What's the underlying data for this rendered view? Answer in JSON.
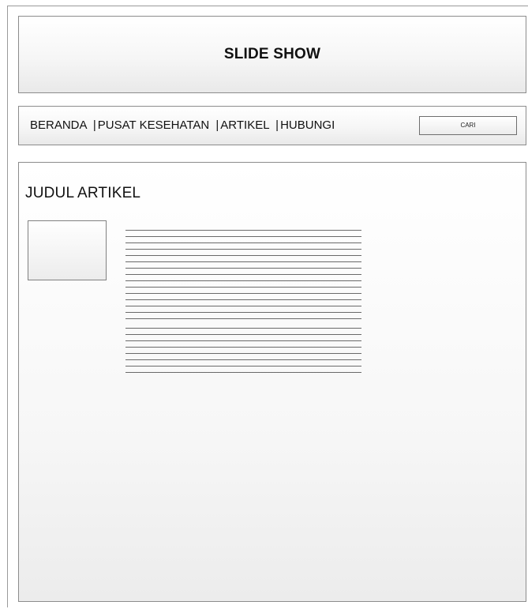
{
  "slideshow": {
    "title": "SLIDE SHOW"
  },
  "nav": {
    "items": [
      {
        "label": "BERANDA"
      },
      {
        "label": "PUSAT KESEHATAN"
      },
      {
        "label": "ARTIKEL"
      },
      {
        "label": "HUBUNGI"
      }
    ],
    "separator": "|",
    "search_label": "CARI"
  },
  "article": {
    "title": "JUDUL ARTIKEL",
    "placeholder_line_groups": [
      15,
      8
    ]
  }
}
